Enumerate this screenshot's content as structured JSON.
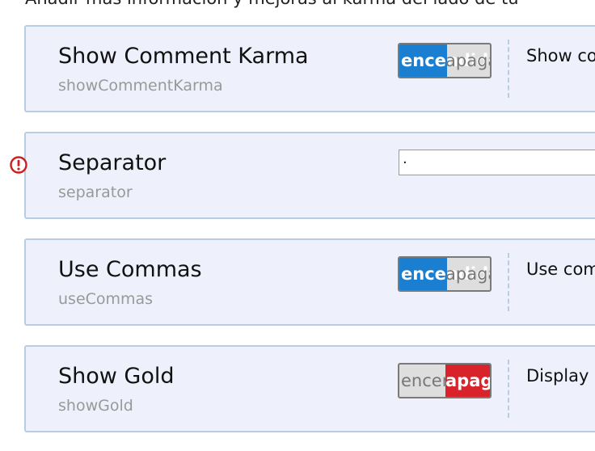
{
  "intro_text": "Añadir más información y mejoras al karma del lado de tu",
  "toggle_labels": {
    "on": "encendido",
    "off": "apagado"
  },
  "colors": {
    "on": "#1a7fd1",
    "off": "#d8232a",
    "panel": "#eef1fc",
    "border": "#b7cde4"
  },
  "options": [
    {
      "title": "Show Comment Karma",
      "key": "showCommentKarma",
      "type": "toggle",
      "state": "on",
      "description": "Show comment karma"
    },
    {
      "title": "Separator",
      "key": "separator",
      "type": "text",
      "value": "·",
      "warning_icon": "exclamation-circle-icon"
    },
    {
      "title": "Use Commas",
      "key": "useCommas",
      "type": "toggle",
      "state": "on",
      "description": "Use commas"
    },
    {
      "title": "Show Gold",
      "key": "showGold",
      "type": "toggle",
      "state": "off",
      "description": "Display"
    }
  ]
}
